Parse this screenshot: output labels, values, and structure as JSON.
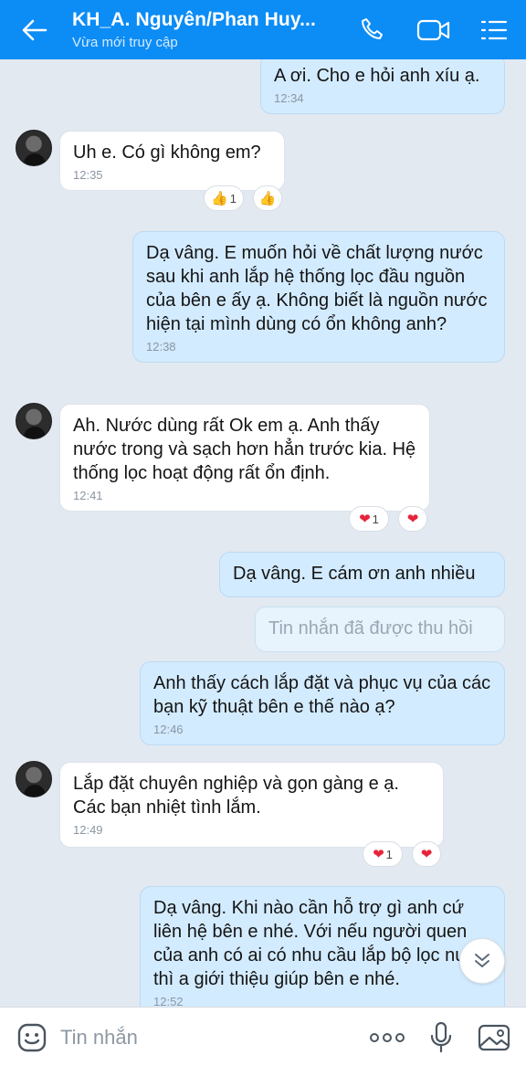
{
  "header": {
    "title": "KH_A. Nguyên/Phan Huy...",
    "subtitle": "Vừa mới truy cập"
  },
  "messages": [
    {
      "text": "A ơi. Cho e hỏi anh xíu ạ.",
      "time": "12:34"
    },
    {
      "text": "Uh e. Có gì không em?",
      "time": "12:35"
    },
    {
      "text": "Dạ vâng. E muốn hỏi về chất lượng nước sau khi anh lắp hệ thống lọc đầu nguồn của bên e ấy ạ. Không biết là nguồn nước hiện tại mình dùng có ổn không anh?",
      "time": "12:38"
    },
    {
      "text": "Ah. Nước dùng rất Ok em ạ. Anh thấy nước trong và sạch hơn hẳn trước kia. Hệ thống lọc hoạt động rất ổn định.",
      "time": "12:41"
    },
    {
      "text": "Dạ vâng. E cám ơn anh nhiều"
    },
    {
      "text": "Tin nhắn đã được thu hồi"
    },
    {
      "text": "Anh thấy cách lắp đặt và phục vụ của các bạn kỹ thuật bên e thế nào ạ?",
      "time": "12:46"
    },
    {
      "text": "Lắp đặt chuyên nghiệp và gọn gàng e ạ. Các bạn nhiệt tình lắm.",
      "time": "12:49"
    },
    {
      "text": "Dạ vâng. Khi nào cần hỗ trợ gì anh cứ liên hệ bên e nhé. Với nếu người quen của anh có ai có nhu cầu lắp bộ lọc nước thì a giới thiệu giúp bên e nhé.",
      "time": "12:52"
    }
  ],
  "reactions": {
    "r1_count": "1",
    "r2_count": "1",
    "r3_count": "1"
  },
  "input": {
    "placeholder": "Tin nhắn"
  },
  "colors": {
    "header": "#0c8cf5",
    "background": "#e2e9f1",
    "outgoing": "#d3ebff",
    "incoming": "#ffffff"
  }
}
